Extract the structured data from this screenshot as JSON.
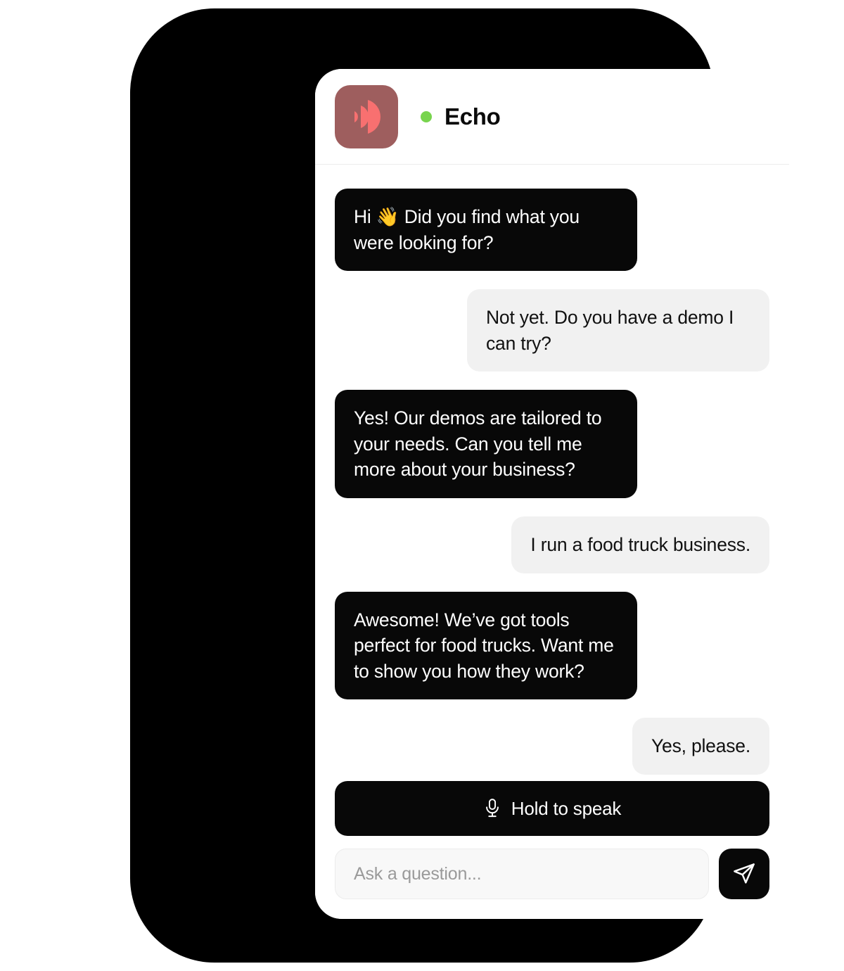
{
  "app": {
    "brand_name": "Echo",
    "logo_icon": "echo-waves-icon",
    "logo_bg_color": "#9e5e5e",
    "logo_wave_color": "#f87070",
    "status_dot_color": "#78d44e",
    "bot_bubble_color": "#080808",
    "user_bubble_color": "#f1f1f1"
  },
  "header": {
    "title": "Echo",
    "status": "online"
  },
  "messages": [
    {
      "sender": "bot",
      "text": "Hi 👋 Did you find what you were looking for?"
    },
    {
      "sender": "user",
      "text": "Not yet. Do you have a demo I can try?"
    },
    {
      "sender": "bot",
      "text": "Yes! Our demos are tailored to your needs. Can you tell me more about your business?"
    },
    {
      "sender": "user",
      "text": "I run a food truck business."
    },
    {
      "sender": "bot",
      "text": "Awesome! We’ve got tools perfect for food trucks. Want me to show you how they work?"
    },
    {
      "sender": "user",
      "text": "Yes, please."
    }
  ],
  "composer": {
    "hold_to_speak_label": "Hold to speak",
    "mic_icon": "microphone-icon",
    "input_placeholder": "Ask a question...",
    "input_value": "",
    "send_icon": "send-paper-plane-icon"
  }
}
